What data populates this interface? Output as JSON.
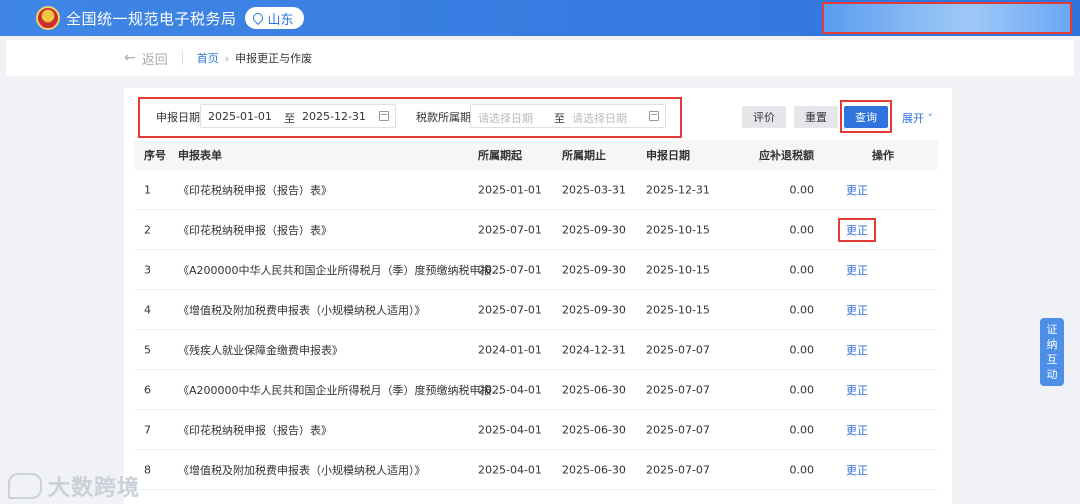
{
  "header": {
    "title": "全国统一规范电子税务局",
    "region": "山东"
  },
  "breadcrumb": {
    "back": "返回",
    "home": "首页",
    "current": "申报更正与作废"
  },
  "filters": {
    "declare_date_label": "申报日期",
    "declare_date_start": "2025-01-01",
    "to": "至",
    "declare_date_end": "2025-12-31",
    "tax_period_label": "税款所属期",
    "tax_period_start_placeholder": "请选择日期",
    "tax_period_end_placeholder": "请选择日期"
  },
  "actions": {
    "evaluate": "评价",
    "reset": "重置",
    "query": "查询",
    "expand": "展开"
  },
  "table": {
    "columns": [
      "序号",
      "申报表单",
      "所属期起",
      "所属期止",
      "申报日期",
      "应补退税额",
      "操作"
    ],
    "rows": [
      {
        "no": "1",
        "form": "《印花税纳税申报（报告）表》",
        "start": "2025-01-01",
        "end": "2025-03-31",
        "date": "2025-12-31",
        "amount": "0.00",
        "op": "更正"
      },
      {
        "no": "2",
        "form": "《印花税纳税申报（报告）表》",
        "start": "2025-07-01",
        "end": "2025-09-30",
        "date": "2025-10-15",
        "amount": "0.00",
        "op": "更正"
      },
      {
        "no": "3",
        "form": "《A200000中华人民共和国企业所得税月（季）度预缴纳税申报...",
        "start": "2025-07-01",
        "end": "2025-09-30",
        "date": "2025-10-15",
        "amount": "0.00",
        "op": "更正"
      },
      {
        "no": "4",
        "form": "《增值税及附加税费申报表（小规模纳税人适用）》",
        "start": "2025-07-01",
        "end": "2025-09-30",
        "date": "2025-10-15",
        "amount": "0.00",
        "op": "更正"
      },
      {
        "no": "5",
        "form": "《残疾人就业保障金缴费申报表》",
        "start": "2024-01-01",
        "end": "2024-12-31",
        "date": "2025-07-07",
        "amount": "0.00",
        "op": "更正"
      },
      {
        "no": "6",
        "form": "《A200000中华人民共和国企业所得税月（季）度预缴纳税申报...",
        "start": "2025-04-01",
        "end": "2025-06-30",
        "date": "2025-07-07",
        "amount": "0.00",
        "op": "更正"
      },
      {
        "no": "7",
        "form": "《印花税纳税申报（报告）表》",
        "start": "2025-04-01",
        "end": "2025-06-30",
        "date": "2025-07-07",
        "amount": "0.00",
        "op": "更正"
      },
      {
        "no": "8",
        "form": "《增值税及附加税费申报表（小规模纳税人适用）》",
        "start": "2025-04-01",
        "end": "2025-06-30",
        "date": "2025-07-07",
        "amount": "0.00",
        "op": "更正"
      }
    ]
  },
  "side_float": [
    "证",
    "纳",
    "互",
    "动"
  ],
  "watermark": "大数跨境",
  "colors": {
    "brand_blue": "#2f74dc",
    "highlight_red": "#e53935"
  }
}
